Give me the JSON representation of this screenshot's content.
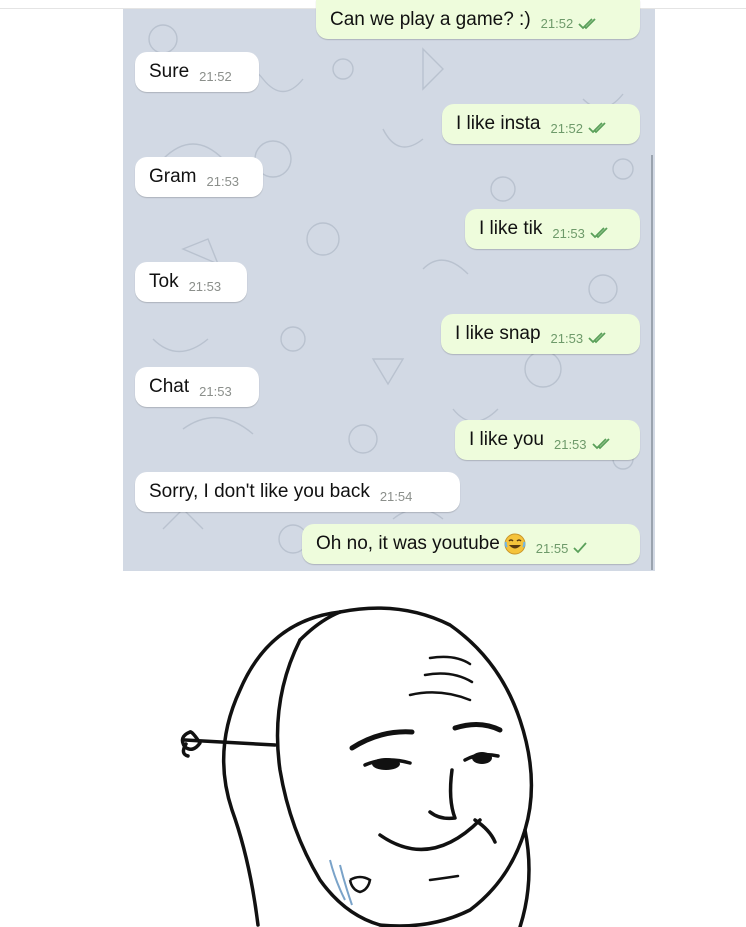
{
  "messages": [
    {
      "text": "Can we play a game? :)",
      "time": "21:52",
      "direction": "outgoing",
      "status": "double-check-icon"
    },
    {
      "text": "Sure",
      "time": "21:52",
      "direction": "incoming"
    },
    {
      "text": "I like insta",
      "time": "21:52",
      "direction": "outgoing",
      "status": "double-check-icon"
    },
    {
      "text": "Gram",
      "time": "21:53",
      "direction": "incoming"
    },
    {
      "text": "I like tik",
      "time": "21:53",
      "direction": "outgoing",
      "status": "double-check-icon"
    },
    {
      "text": "Tok",
      "time": "21:53",
      "direction": "incoming"
    },
    {
      "text": "I like snap",
      "time": "21:53",
      "direction": "outgoing",
      "status": "double-check-icon"
    },
    {
      "text": "Chat",
      "time": "21:53",
      "direction": "incoming"
    },
    {
      "text": "I like you",
      "time": "21:53",
      "direction": "outgoing",
      "status": "double-check-icon"
    },
    {
      "text": "Sorry, I don't like you back",
      "time": "21:54",
      "direction": "incoming"
    },
    {
      "text": "Oh no, it was youtube",
      "time": "21:55",
      "direction": "outgoing",
      "status": "single-check-icon",
      "emoji": "laughing-emoji-icon"
    }
  ],
  "colors": {
    "chat_background": "#d2d9e4",
    "incoming_bubble": "#ffffff",
    "outgoing_bubble": "#eefcdc",
    "check_color": "#5aa05a"
  },
  "meme": {
    "image": "wojak-smirk-face-with-mask"
  }
}
